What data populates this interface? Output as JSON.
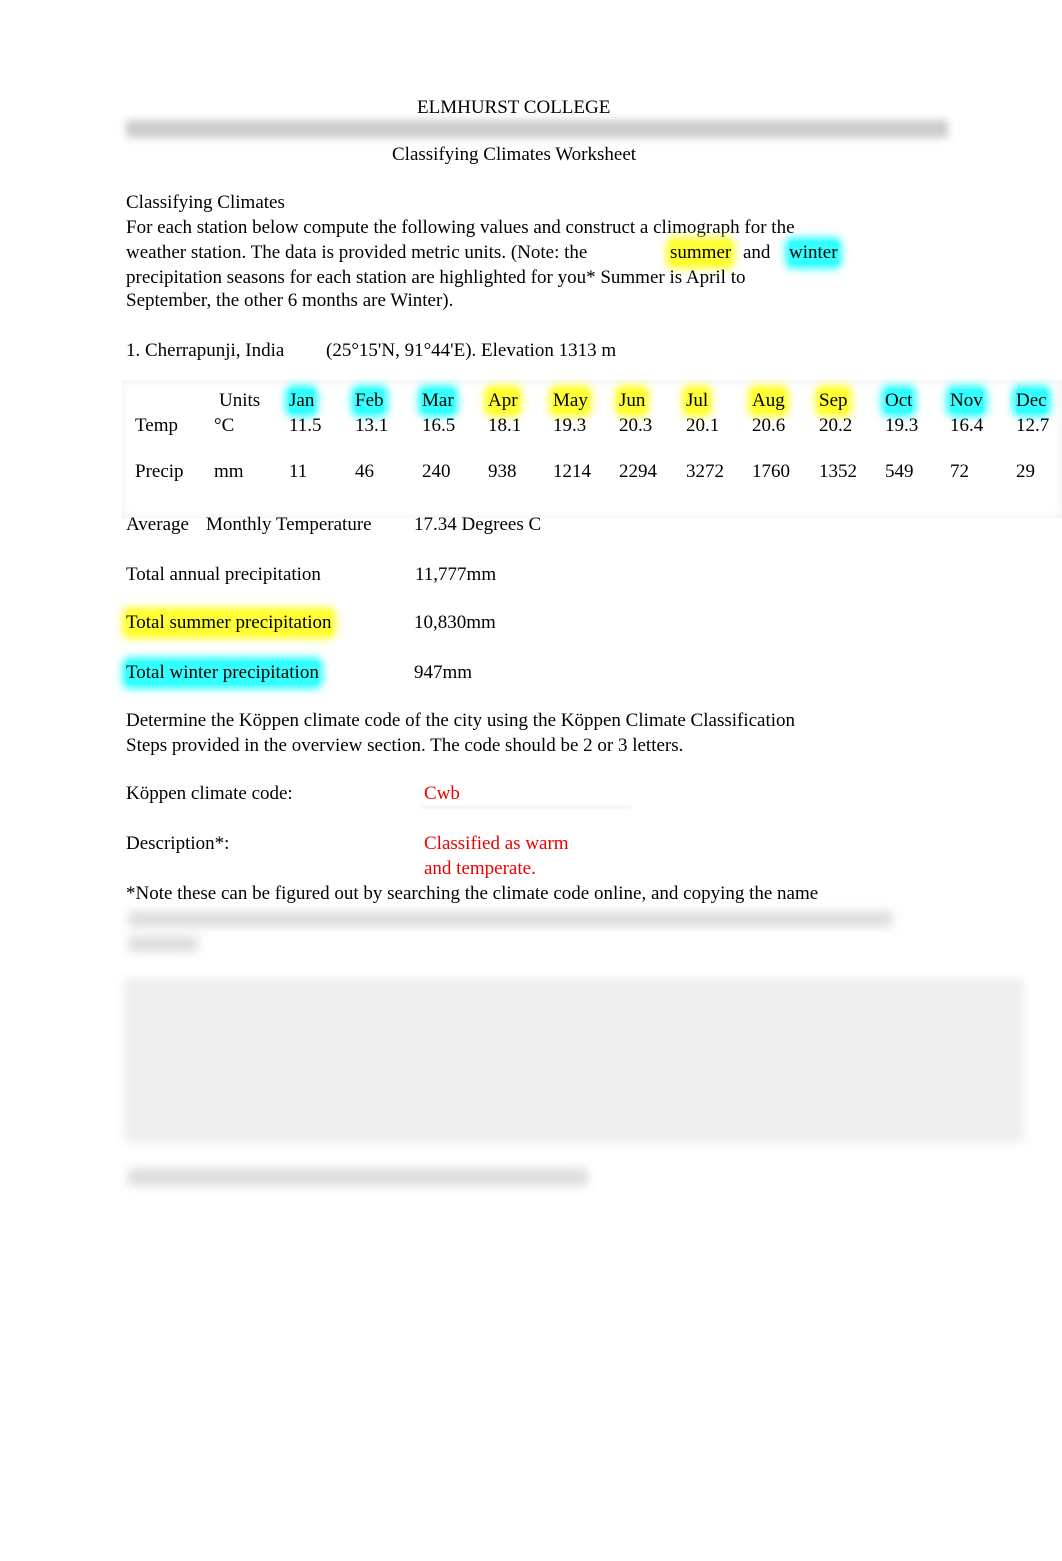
{
  "header": {
    "college": "ELMHURST COLLEGE",
    "title": "Classifying Climates Worksheet"
  },
  "intro": {
    "heading": "Classifying Climates",
    "line1": "For each station below compute the following values and construct a climograph for the",
    "line2a": "weather station. The data is provided metric units. (Note: the",
    "summer": "summer",
    "and": "and",
    "winter": "winter",
    "line3": "precipitation seasons for each station are highlighted for you* Summer is April to",
    "line4": "September, the other 6 months are Winter)."
  },
  "station": {
    "name": "1. Cherrapunji, India",
    "coords": "(25°15'N, 91°44'E). Elevation 1313 m"
  },
  "table": {
    "units_header": "Units",
    "months": [
      {
        "m": "Jan",
        "s": "winter"
      },
      {
        "m": "Feb",
        "s": "winter"
      },
      {
        "m": "Mar",
        "s": "winter"
      },
      {
        "m": "Apr",
        "s": "summer"
      },
      {
        "m": "May",
        "s": "summer"
      },
      {
        "m": "Jun",
        "s": "summer"
      },
      {
        "m": "Jul",
        "s": "summer"
      },
      {
        "m": "Aug",
        "s": "summer"
      },
      {
        "m": "Sep",
        "s": "summer"
      },
      {
        "m": "Oct",
        "s": "winter"
      },
      {
        "m": "Nov",
        "s": "winter"
      },
      {
        "m": "Dec",
        "s": "winter"
      }
    ],
    "rows": [
      {
        "label": "Temp",
        "unit": "°C",
        "values": [
          "11.5",
          "13.1",
          "16.5",
          "18.1",
          "19.3",
          "20.3",
          "20.1",
          "20.6",
          "20.2",
          "19.3",
          "16.4",
          "12.7"
        ]
      },
      {
        "label": "Precip",
        "unit": "mm",
        "values": [
          "11",
          "46",
          "240",
          "938",
          "1214",
          "2294",
          "3272",
          "1760",
          "1352",
          "549",
          "72",
          "29"
        ]
      }
    ]
  },
  "results": {
    "avg_label_a": "Average",
    "avg_label_b": "Monthly Temperature",
    "avg_value": "17.34 Degrees C",
    "total_label": "Total annual precipitation",
    "total_value": "11,777mm",
    "summer_label": "Total summer precipitation",
    "summer_value": "10,830mm",
    "winter_label": "Total winter precipitation",
    "winter_value": "947mm"
  },
  "koppen": {
    "line1": "Determine the Köppen climate code of the city using the Köppen Climate Classification",
    "line2": "Steps provided in the overview section. The code should be 2 or 3 letters.",
    "code_label": "Köppen climate code:",
    "code_value": "Cwb",
    "desc_label": "Description*:",
    "desc_value1": "Classified as warm",
    "desc_value2": "and temperate.",
    "note": "*Note these can be figured out by searching the climate code online, and copying the name"
  },
  "colors": {
    "summer": "#ffff33",
    "winter": "#33ffff",
    "answer": "#ee0000"
  }
}
